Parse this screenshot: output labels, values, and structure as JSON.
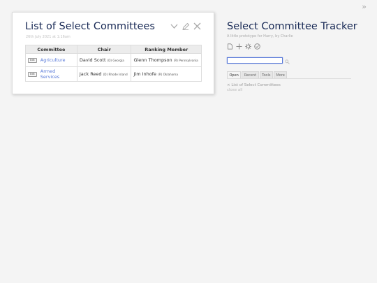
{
  "expand_icon": "»",
  "tiddler": {
    "title": "List of Select Committees",
    "subtitle": "26th July 2021 at 1:16am",
    "controls": [
      "chevron-down-icon",
      "edit-pencil-icon",
      "close-icon"
    ],
    "table": {
      "headers": [
        "Committee",
        "Chair",
        "Ranking Member"
      ],
      "edit_label": "Edit",
      "rows": [
        {
          "committee": "Agriculture",
          "chair_name": "David Scott",
          "chair_detail": "(D) Georgia",
          "ranking_name": "Glenn Thompson",
          "ranking_detail": "(R) Pennsylvania"
        },
        {
          "committee": "Armed Services",
          "chair_name": "Jack Reed",
          "chair_detail": "(D) Rhode Island",
          "ranking_name": "Jim Inhofe",
          "ranking_detail": "(R) Oklahoma"
        }
      ]
    }
  },
  "sidebar": {
    "title": "Select Committee Tracker",
    "subtitle": "A little prototype for Harry, by Charlie",
    "controls": [
      "new-tiddler-icon",
      "plus-icon",
      "gear-icon",
      "check-circle-icon"
    ],
    "search": {
      "value": "",
      "placeholder": ""
    },
    "tabs": [
      "Open",
      "Recent",
      "Tools",
      "More"
    ],
    "active_tab": "Open",
    "open_items": [
      {
        "close_glyph": "×",
        "label": "List of Select Committees"
      }
    ],
    "close_all_label": "close all"
  },
  "colors": {
    "title": "#182955",
    "link": "#5778d8",
    "background": "#f4f4f4"
  }
}
